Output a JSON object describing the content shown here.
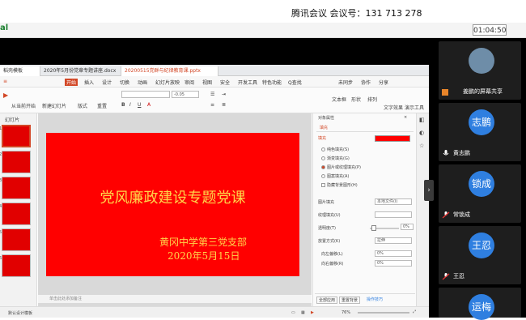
{
  "meeting": {
    "title": "腾讯会议 会议号：131 713 278",
    "timer": "01:04:50"
  },
  "wps": {
    "tabs": [
      "稻壳模板",
      "2020年5月份党章专题讲座.docx",
      "20200515党群与纪律教育课.pptx"
    ],
    "menu": [
      "开始",
      "插入",
      "设计",
      "切换",
      "动画",
      "幻灯片放映",
      "审阅",
      "视图",
      "安全",
      "开发工具",
      "特色功能",
      "Q查找"
    ],
    "menu_right": [
      "未同步",
      "协作",
      "分享"
    ],
    "toolbar_left": [
      "从当前开始",
      "新建幻灯片",
      "版式",
      "重置"
    ],
    "toolbar_right": [
      "文本框",
      "形状",
      "排列",
      "文字效果",
      "演示工具"
    ],
    "font_size": "-0.05",
    "thumb_label": "幻灯片",
    "thumb_numbers": [
      "1",
      "2",
      "3",
      "4",
      "5",
      "6"
    ]
  },
  "slide": {
    "title": "党风廉政建设专题党课",
    "org": "黄冈中学第三党支部",
    "date": "2020年5月15日"
  },
  "notes_placeholder": "单击此处添加备注",
  "prop_panel": {
    "header": "对象属性",
    "tab": "填充",
    "fill_label": "填充",
    "options": [
      "纯色填充(S)",
      "渐变填充(G)",
      "图片或纹理填充(P)",
      "图案填充(A)",
      "隐藏背景图形(H)"
    ],
    "image_fill_label": "图片填充",
    "image_fill_value": "本地文件(I)",
    "texture_label": "纹理填充(U)",
    "transparency_label": "透明度(T)",
    "transparency_value": "0%",
    "tile_label": "放置方式(K)",
    "tile_value": "拉伸",
    "offset_left_label": "向左偏移(L)",
    "offset_left_value": "0%",
    "offset_right_label": "向右偏移(R)",
    "offset_right_value": "0%",
    "bottom_tabs": [
      "全部应用",
      "重置背景"
    ],
    "bottom_link": "操作技巧"
  },
  "statusbar": {
    "left": "默认设计模板",
    "zoom": "76%"
  },
  "participants": [
    {
      "name": "姜鹏的屏幕共享",
      "initials": ""
    },
    {
      "name": "黄志鹏",
      "initials": "志鹏"
    },
    {
      "name": "常锁成",
      "initials": "锁成"
    },
    {
      "name": "王忍",
      "initials": "王忍"
    },
    {
      "name": "",
      "initials": "运梅"
    }
  ],
  "colors": {
    "slide_bg": "#ff0000",
    "slide_text": "#ffd54a",
    "avatar_blue": "#2f7fe0",
    "accent_orange": "#d24726"
  }
}
